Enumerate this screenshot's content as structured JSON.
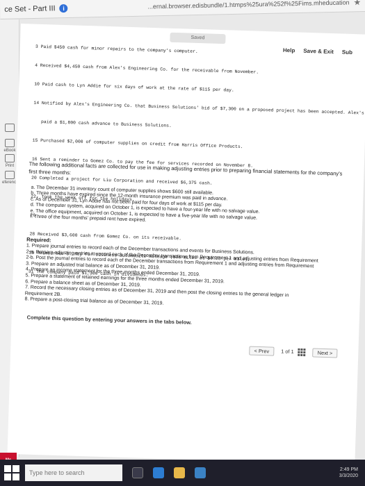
{
  "browser": {
    "tab_title": "ce Set - Part III",
    "info_badge": "i",
    "url": "...ernal.browser.edisbundle/1.htmps%25ura%252f%25Fims.mheducation.com%...",
    "star_icon": "★"
  },
  "left_rail": {
    "items": [
      {
        "label": "",
        "icon": "book-icon"
      },
      {
        "label": "eBook",
        "icon": "ebook-icon"
      },
      {
        "label": "Print",
        "icon": "print-icon"
      },
      {
        "label": "eferences",
        "icon": "references-icon"
      }
    ]
  },
  "header": {
    "send_label": "Saved",
    "help_label": "Help",
    "save_exit_label": "Save & Exit",
    "submit_label": "Sub"
  },
  "transactions": [
    "3 Paid $450 cash for minor repairs to the company's computer.",
    "4 Received $4,450 cash from Alex's Engineering Co. for the receivable from November.",
    "10 Paid cash to Lyn Addie for six days of work at the rate of $115 per day.",
    "14 Notified by Alex's Engineering Co. that Business Solutions' bid of $7,300 on a proposed project has been accepted. Alex's",
    "   paid a $1,800 cash advance to Business Solutions.",
    "15 Purchased $2,000 of computer supplies on credit from Harris Office Products.",
    "16 Sent a reminder to Gomez Co. to pay the fee for services recorded on November 8.",
    "20 Completed a project for Liu Corporation and received $6,375 cash.",
    "22- Took the week off for the holidays.",
    "26",
    "28 Received $3,600 cash from Gomez Co. on its receivable.",
    "29 Reimbursed S. Rey for business automobile mileage (500 miles at $0.28 per mile).",
    "31 The company paid $1,300 cash in dividends."
  ],
  "facts_intro": "The following additional facts are collected for use in making adjusting entries prior to preparing financial statements for the company's first three months:",
  "facts": [
    "a. The December 31 inventory count of computer supplies shows $600 still available.",
    "b. Three months have expired since the 12-month insurance premium was paid in advance.",
    "c. As of December 31, Lyn Addie has not been paid for four days of work at $115 per day.",
    "d. The computer system, acquired on October 1, is expected to have a four-year life with no salvage value.",
    "e. The office equipment, acquired on October 1, is expected to have a five-year life with no salvage value.",
    "f. Three of the four months' prepaid rent have expired."
  ],
  "required_title": "Required:",
  "requirements": [
    "1. Prepare journal entries to record each of the December transactions and events for Business Solutions.",
    "2-a. Prepare adjusting entries to record each of the December transactions from Requirement 1 and adjusting entries from Requirement",
    "2-b. Post the journal entries to record each of the December transactions from Requirement 1 and adjusting entries from Requirement",
    "3. Prepare an adjusted trial balance as of December 31, 2019.",
    "4. Prepare an income statement for the three months ended December 31, 2019.",
    "5. Prepare a statement of retained earnings for the three months ended December 31, 2019.",
    "6. Prepare a balance sheet as of December 31, 2019.",
    "7. Record the necessary closing entries as of December 31, 2019 and then post the closing entries to the general ledger in",
    "   Requirement 2B.",
    "8. Prepare a post-closing trial balance as of December 31, 2019."
  ],
  "tabs_note": "Complete this question by entering your answers in the tabs below.",
  "pager": {
    "prev_label": "< Prev",
    "page_current": "1",
    "page_of": "of",
    "page_total": "1",
    "next_label": "Next >"
  },
  "taskbar": {
    "search_placeholder": "Type here to search",
    "time": "2:49 PM",
    "date": "3/3/2020"
  },
  "brand_badge": "Mc Graw Hill"
}
